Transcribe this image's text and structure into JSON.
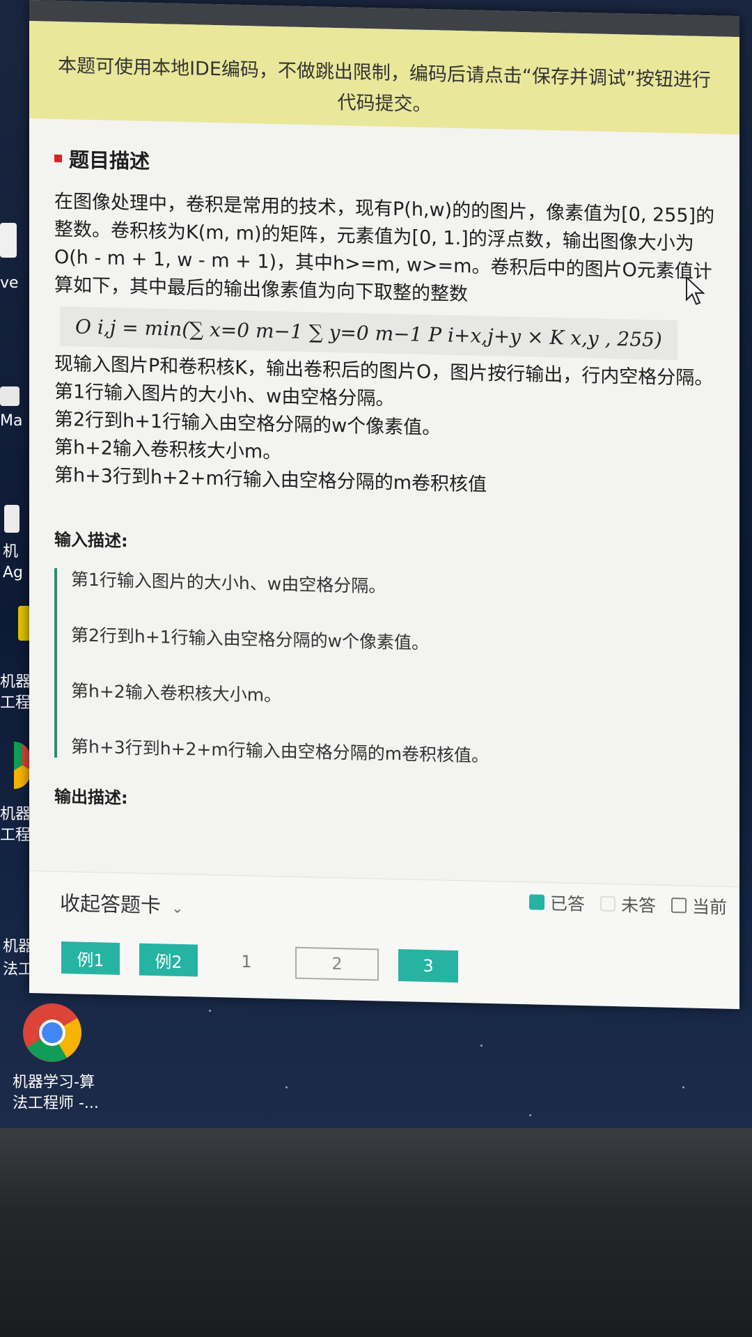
{
  "notice": "本题可使用本地IDE编码，不做跳出限制，编码后请点击“保存并调试”按钮进行代码提交。",
  "section_title": "题目描述",
  "description": "在图像处理中，卷积是常用的技术，现有P(h,w)的的图片，像素值为[0, 255]的整数。卷积核为K(m, m)的矩阵，元素值为[0, 1.]的浮点数，输出图像大小为O(h - m + 1, w - m + 1)，其中h>=m, w>=m。卷积后中的图片O元素值计算如下，其中最后的输出像素值为向下取整的整数",
  "formula": "O i,j = min(∑ x=0 m−1 ∑ y=0 m−1 P i+x,j+y × K x,y , 255)",
  "lines": [
    "现输入图片P和卷积核K，输出卷积后的图片O，图片按行输出，行内空格分隔。",
    "第1行输入图片的大小h、w由空格分隔。",
    "第2行到h+1行输入由空格分隔的w个像素值。",
    "第h+2输入卷积核大小m。",
    "第h+3行到h+2+m行输入由空格分隔的m卷积核值"
  ],
  "input_title": "输入描述:",
  "input_lines": [
    "第1行输入图片的大小h、w由空格分隔。",
    "第2行到h+1行输入由空格分隔的w个像素值。",
    "第h+2输入卷积核大小m。",
    "第h+3行到h+2+m行输入由空格分隔的m卷积核值。"
  ],
  "output_title": "输出描述:",
  "answer_card": {
    "collapse_label": "收起答题卡",
    "legend": {
      "answered": "已答",
      "unanswered": "未答",
      "current": "当前"
    },
    "buttons": [
      "例1",
      "例2",
      "1",
      "2",
      "3"
    ]
  },
  "desktop": {
    "icon_labels": [
      "ve",
      "Ma",
      "机",
      "Ag",
      "机器",
      "工程",
      "机器",
      "工程",
      "机器",
      "法工"
    ],
    "chrome_shortcut": [
      "机器学习-算",
      "法工程师 -..."
    ]
  },
  "colors": {
    "accent": "#27b3a2",
    "notice_bg": "#e9e79a",
    "title_marker": "#d22222"
  }
}
